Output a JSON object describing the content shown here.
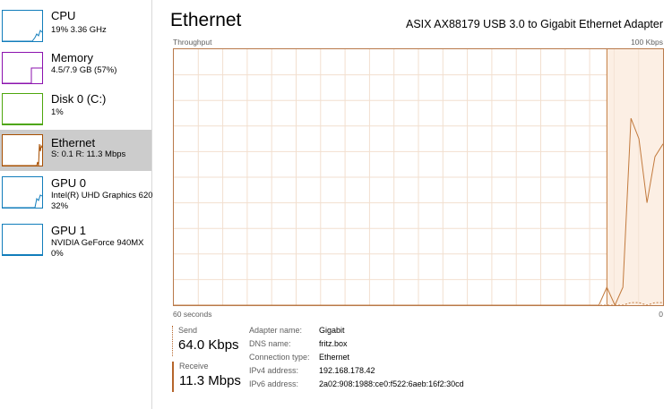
{
  "sidebar": {
    "items": [
      {
        "title": "CPU",
        "sub1": "19%  3.36 GHz",
        "sub2": "",
        "color": "#117dbb",
        "selected": false
      },
      {
        "title": "Memory",
        "sub1": "4.5/7.9 GB (57%)",
        "sub2": "",
        "color": "#8b12ae",
        "selected": false
      },
      {
        "title": "Disk 0 (C:)",
        "sub1": "1%",
        "sub2": "",
        "color": "#4da60c",
        "selected": false
      },
      {
        "title": "Ethernet",
        "sub1": "S: 0.1  R: 11.3 Mbps",
        "sub2": "",
        "color": "#a74f01",
        "selected": true
      },
      {
        "title": "GPU 0",
        "sub1": "Intel(R) UHD Graphics 620",
        "sub2": "32%",
        "color": "#117dbb",
        "selected": false
      },
      {
        "title": "GPU 1",
        "sub1": "NVIDIA GeForce 940MX",
        "sub2": "0%",
        "color": "#117dbb",
        "selected": false
      }
    ]
  },
  "main": {
    "title": "Ethernet",
    "adapter": "ASIX AX88179 USB 3.0 to Gigabit Ethernet Adapter",
    "graph": {
      "top_left_label": "Throughput",
      "top_right_label": "100 Kbps",
      "bottom_left_label": "60 seconds",
      "bottom_right_label": "0",
      "line_color": "#c27a3d",
      "fill_color": "#fcefe4",
      "grid_color": "#f2dfcf",
      "receive_series": [
        0,
        0,
        0,
        0,
        0,
        0,
        0,
        0,
        0,
        0,
        0,
        0,
        0,
        0,
        0,
        0,
        0,
        0,
        0,
        0,
        0,
        0,
        0,
        0,
        0,
        0,
        0,
        0,
        0,
        0,
        0,
        0,
        0,
        0,
        0,
        0,
        0,
        0,
        0,
        0,
        0,
        0,
        0,
        0,
        0,
        0,
        0,
        0,
        0,
        0,
        0,
        0,
        0,
        0,
        7,
        0,
        7,
        73,
        65,
        40,
        58,
        63
      ],
      "send_series": [
        0,
        0,
        0,
        0,
        0,
        0,
        0,
        0,
        0,
        0,
        0,
        0,
        0,
        0,
        0,
        0,
        0,
        0,
        0,
        0,
        0,
        0,
        0,
        0,
        0,
        0,
        0,
        0,
        0,
        0,
        0,
        0,
        0,
        0,
        0,
        0,
        0,
        0,
        0,
        0,
        0,
        0,
        0,
        0,
        0,
        0,
        0,
        0,
        0,
        0,
        0,
        0,
        0,
        0,
        0,
        0,
        0,
        1,
        1,
        0,
        1,
        1
      ]
    },
    "send": {
      "label": "Send",
      "value": "64.0 Kbps"
    },
    "receive": {
      "label": "Receive",
      "value": "11.3 Mbps"
    },
    "details": [
      {
        "key": "Adapter name:",
        "value": "Gigabit"
      },
      {
        "key": "DNS name:",
        "value": "fritz.box"
      },
      {
        "key": "Connection type:",
        "value": "Ethernet"
      },
      {
        "key": "IPv4 address:",
        "value": "192.168.178.42"
      },
      {
        "key": "IPv6 address:",
        "value": "2a02:908:1988:ce0:f522:6aeb:16f2:30cd"
      }
    ]
  }
}
